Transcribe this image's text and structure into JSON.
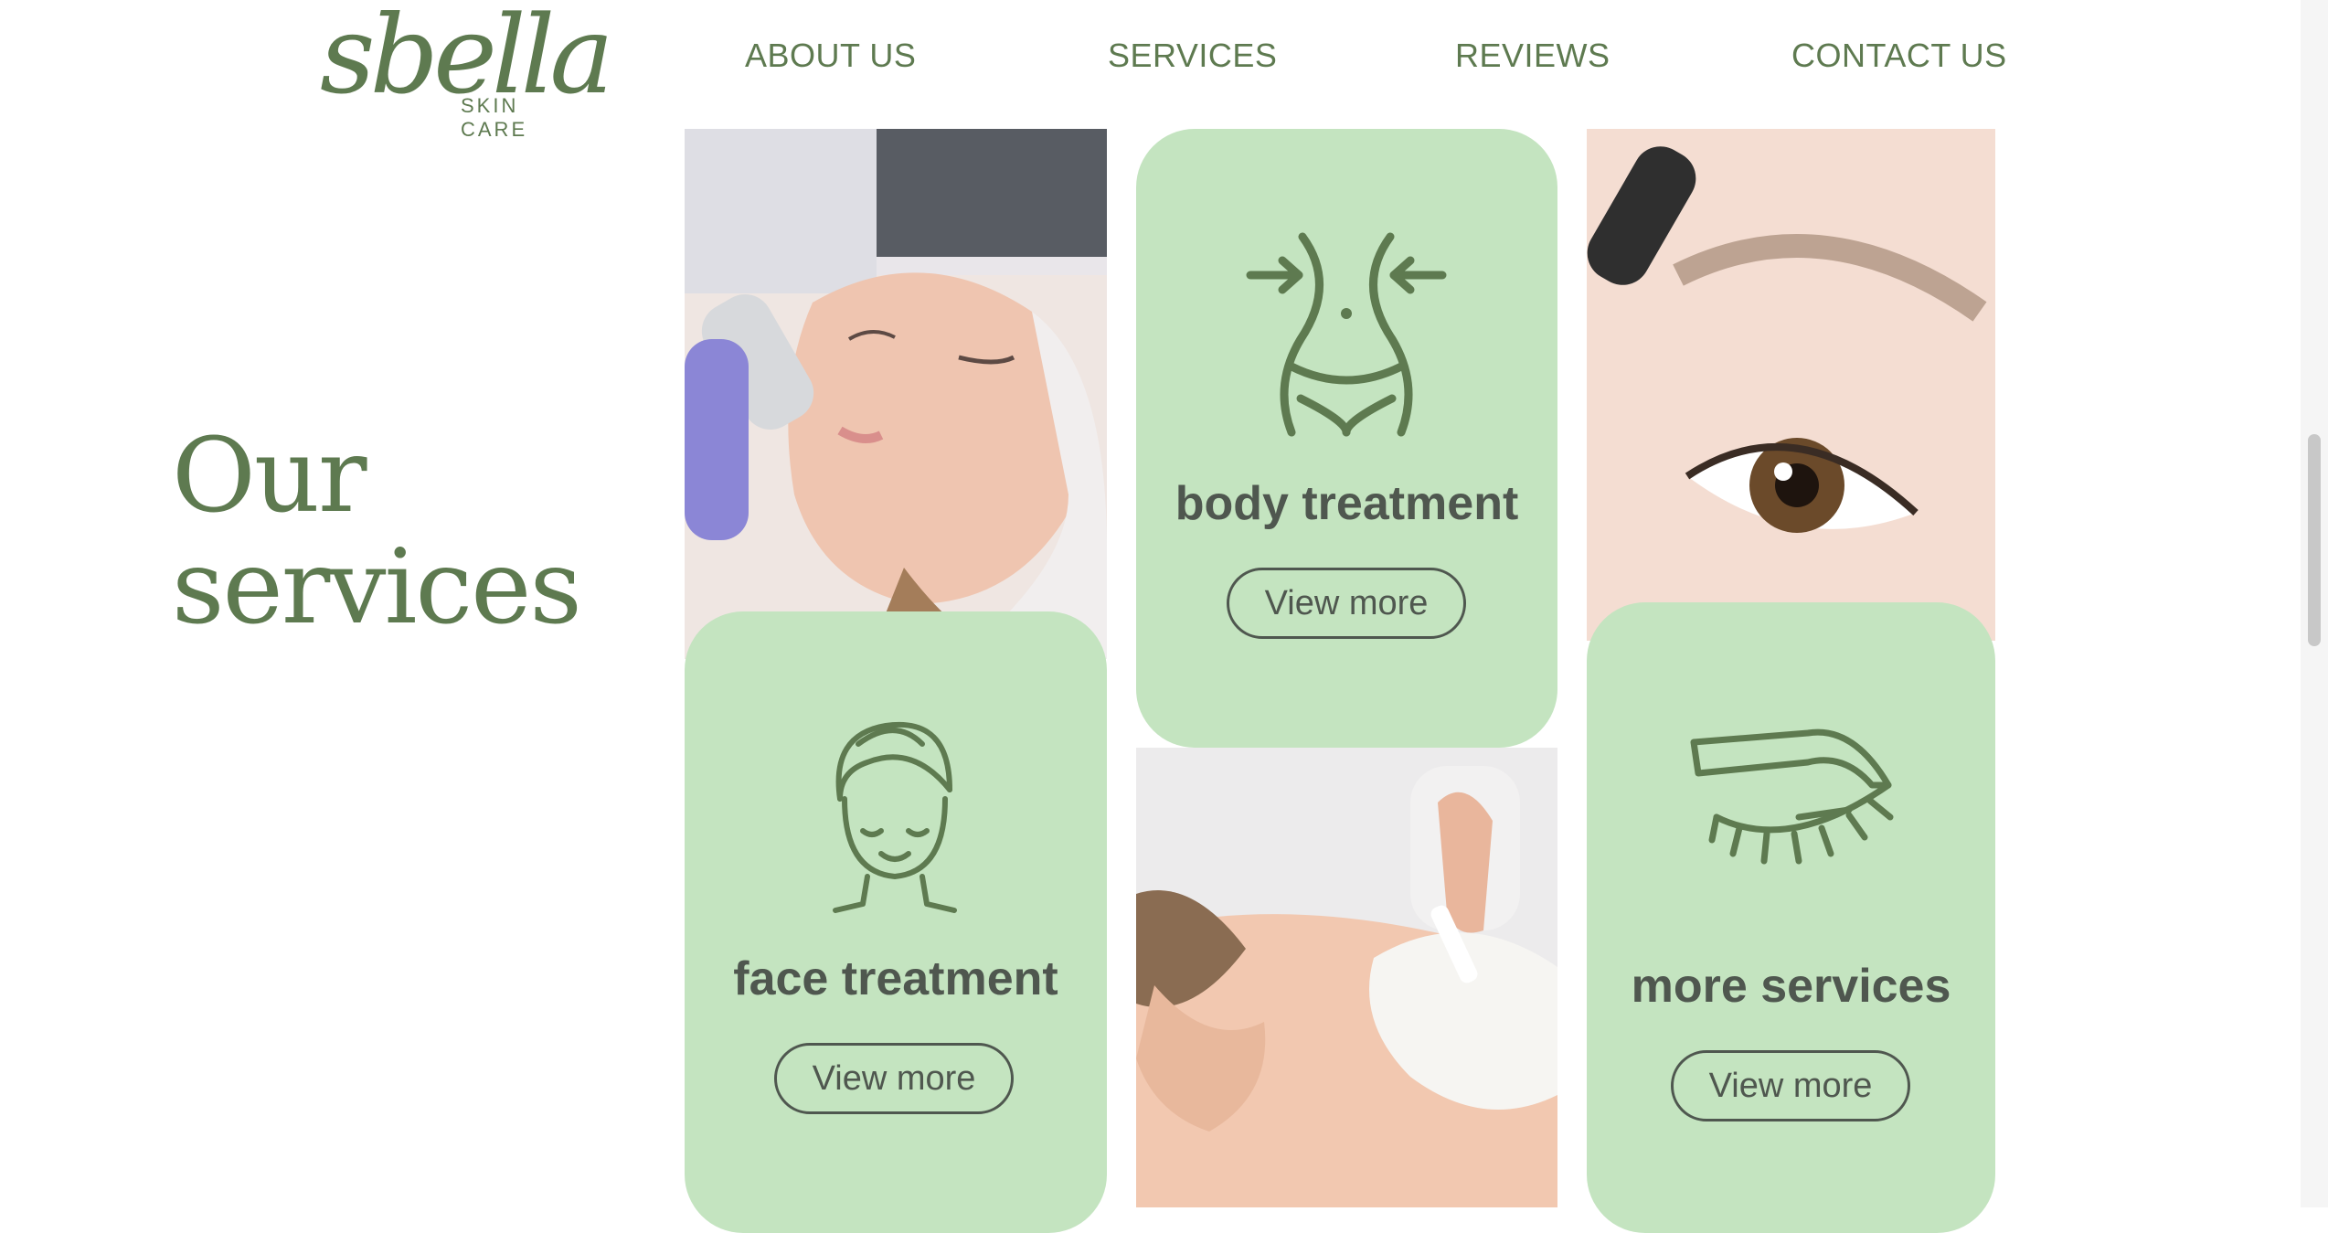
{
  "brand": {
    "name": "sbella",
    "tagline": "SKIN CARE"
  },
  "nav": {
    "about": "ABOUT US",
    "services": "SERVICES",
    "reviews": "REVIEWS",
    "contact": "CONTACT US"
  },
  "section": {
    "heading_line1": "Our",
    "heading_line2": "services"
  },
  "cards": {
    "face": {
      "title": "face treatment",
      "button": "View more",
      "icon": "woman-towel-face-icon"
    },
    "body": {
      "title": "body treatment",
      "button": "View more",
      "icon": "waist-slimming-icon"
    },
    "more": {
      "title": "more services",
      "button": "View more",
      "icon": "eyebrow-lash-icon"
    }
  },
  "colors": {
    "brand_green": "#5e7a50",
    "card_green": "#c4e4c0",
    "text_dark": "#4f574f",
    "background": "#ffffff"
  }
}
